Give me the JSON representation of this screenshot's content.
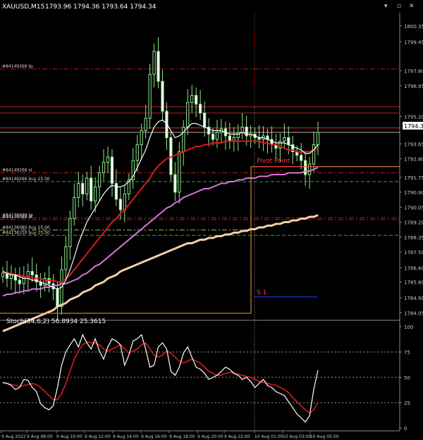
{
  "header": {
    "symbol": "XAUUSD,M15",
    "ohlc": "1793.96 1794.36 1793.64 1794.34"
  },
  "window_controls": {
    "minimize": "▾",
    "maximize": "▫",
    "close": "✕"
  },
  "price_axis": {
    "ticks": [
      "1800.35",
      "1799.45",
      "1797.80",
      "1796.95",
      "1795.20",
      "1794.34",
      "1793.65",
      "1792.80",
      "1791.75",
      "1790.90",
      "1790.05",
      "1789.20",
      "1788.35",
      "1787.50",
      "1786.60",
      "1785.80",
      "1784.90",
      "1784.05"
    ],
    "current_price": "1794.34",
    "colors": {
      "bg": "#000000",
      "grid": "#2f2f2f",
      "text": "#c8c8c8"
    }
  },
  "order_labels": [
    {
      "text": "#84149266 tp",
      "price": 1797.9
    },
    {
      "text": "#84149266 sl",
      "price": 1792.0
    },
    {
      "text": "#84149266 buy 25.00",
      "price": 1791.5
    },
    {
      "text": "#84136099 tp",
      "price": 1789.45
    },
    {
      "text": "#84136099 sl",
      "price": 1789.35
    },
    {
      "text": "#84136080 buy 25.00",
      "price": 1788.75
    },
    {
      "text": "#84136150 buy 25.00",
      "price": 1788.45
    }
  ],
  "pivot": {
    "label": "Pivot Point",
    "s1_label": "S 1",
    "price": 1792.35,
    "s1_price": 1784.95
  },
  "stoch": {
    "title": "Stoch(34,6,2) 56.8934 25.3615",
    "ticks": [
      "100",
      "75",
      "50",
      "25",
      "0"
    ],
    "levels": [
      75,
      50,
      25
    ]
  },
  "time_axis": {
    "labels": [
      "9 Aug 2022",
      "9 Aug 08:00",
      "9 Aug 10:00",
      "9 Aug 12:00",
      "9 Aug 14:00",
      "9 Aug 16:00",
      "9 Aug 18:00",
      "9 Aug 20:00",
      "9 Aug 22:00",
      "10 Aug 01:00",
      "10 Aug 03:00",
      "10 Aug 05:00"
    ]
  },
  "chart_data": {
    "type": "line",
    "title": "XAUUSD,M15",
    "price_range": [
      1783.7,
      1801.1
    ],
    "closes": [
      1786.3,
      1786.0,
      1786.2,
      1785.9,
      1785.7,
      1786.1,
      1786.4,
      1786.2,
      1785.8,
      1785.6,
      1786.0,
      1785.7,
      1785.4,
      1784.4,
      1786.5,
      1787.8,
      1789.4,
      1790.6,
      1791.4,
      1790.8,
      1791.7,
      1790.4,
      1791.2,
      1792.0,
      1792.6,
      1792.9,
      1791.4,
      1790.5,
      1789.9,
      1790.8,
      1791.6,
      1792.7,
      1793.6,
      1794.4,
      1795.1,
      1797.6,
      1798.9,
      1797.2,
      1795.5,
      1794.0,
      1791.9,
      1790.9,
      1793.2,
      1794.6,
      1796.0,
      1796.4,
      1795.9,
      1795.4,
      1794.6,
      1794.2,
      1793.9,
      1794.3,
      1794.5,
      1794.1,
      1793.8,
      1794.0,
      1794.3,
      1794.6,
      1794.1,
      1794.2,
      1794.0,
      1793.9,
      1794.1,
      1793.9,
      1793.6,
      1793.4,
      1793.8,
      1794.0,
      1793.6,
      1793.2,
      1793.0,
      1792.7,
      1791.9,
      1792.5,
      1793.6,
      1794.3
    ],
    "ma_fast": [
      1786.4,
      1786.3,
      1786.2,
      1786.2,
      1786.1,
      1786.0,
      1786.0,
      1785.9,
      1785.9,
      1785.8,
      1785.7,
      1785.6,
      1785.5,
      1785.4,
      1785.5,
      1785.9,
      1786.5,
      1787.2,
      1788.0,
      1788.6,
      1789.2,
      1789.6,
      1790.0,
      1790.4,
      1790.8,
      1791.1,
      1791.3,
      1791.2,
      1791.2,
      1791.3,
      1791.5,
      1791.8,
      1792.3,
      1792.8,
      1793.3,
      1794.0,
      1794.6,
      1794.9,
      1795.0,
      1794.8,
      1794.4,
      1794.0,
      1794.1,
      1794.3,
      1794.6,
      1794.8,
      1794.8,
      1794.7,
      1794.6,
      1794.5,
      1794.4,
      1794.4,
      1794.4,
      1794.3,
      1794.2,
      1794.2,
      1794.2,
      1794.3,
      1794.2,
      1794.2,
      1794.1,
      1794.0,
      1794.0,
      1793.9,
      1793.8,
      1793.7,
      1793.7,
      1793.7,
      1793.6,
      1793.5,
      1793.4,
      1793.3,
      1793.1,
      1793.1,
      1793.3,
      1793.6
    ],
    "ma_mid": [
      1786.4,
      1786.3,
      1786.3,
      1786.2,
      1786.2,
      1786.1,
      1786.1,
      1786.0,
      1786.0,
      1786.0,
      1785.9,
      1785.9,
      1785.9,
      1785.8,
      1785.8,
      1786.0,
      1786.2,
      1786.5,
      1786.8,
      1787.1,
      1787.4,
      1787.7,
      1788.0,
      1788.3,
      1788.6,
      1788.9,
      1789.2,
      1789.4,
      1789.7,
      1789.9,
      1790.2,
      1790.5,
      1790.8,
      1791.1,
      1791.4,
      1791.7,
      1792.1,
      1792.4,
      1792.6,
      1792.8,
      1792.9,
      1793.0,
      1793.1,
      1793.2,
      1793.3,
      1793.4,
      1793.5,
      1793.5,
      1793.6,
      1793.6,
      1793.7,
      1793.7,
      1793.7,
      1793.8,
      1793.8,
      1793.8,
      1793.8,
      1793.8,
      1793.8,
      1793.8,
      1793.8,
      1793.8,
      1793.7,
      1793.7,
      1793.6,
      1793.6,
      1793.5,
      1793.4,
      1793.3,
      1793.3,
      1793.2,
      1793.2,
      1793.2,
      1793.2,
      1793.3,
      1793.4
    ],
    "ma_slow": [
      1785.0,
      1785.1,
      1785.1,
      1785.2,
      1785.2,
      1785.3,
      1785.3,
      1785.4,
      1785.4,
      1785.4,
      1785.5,
      1785.5,
      1785.6,
      1785.6,
      1785.7,
      1785.7,
      1785.8,
      1785.9,
      1786.0,
      1786.2,
      1786.3,
      1786.5,
      1786.7,
      1786.8,
      1787.0,
      1787.2,
      1787.4,
      1787.6,
      1787.8,
      1788.0,
      1788.2,
      1788.4,
      1788.6,
      1788.8,
      1789.0,
      1789.2,
      1789.4,
      1789.6,
      1789.8,
      1790.0,
      1790.1,
      1790.3,
      1790.4,
      1790.6,
      1790.7,
      1790.8,
      1790.9,
      1791.0,
      1791.1,
      1791.1,
      1791.2,
      1791.3,
      1791.4,
      1791.4,
      1791.5,
      1791.5,
      1791.6,
      1791.6,
      1791.7,
      1791.7,
      1791.7,
      1791.8,
      1791.8,
      1791.8,
      1791.9,
      1791.9,
      1791.9,
      1791.9,
      1792.0,
      1792.0,
      1792.0,
      1792.0,
      1792.1,
      1792.1,
      1792.2,
      1792.3
    ],
    "ma_very_slow": [
      1783.0,
      1783.1,
      1783.2,
      1783.3,
      1783.4,
      1783.5,
      1783.6,
      1783.7,
      1783.8,
      1783.9,
      1784.0,
      1784.1,
      1784.2,
      1784.4,
      1784.5,
      1784.6,
      1784.8,
      1784.9,
      1785.0,
      1785.2,
      1785.3,
      1785.4,
      1785.6,
      1785.7,
      1785.8,
      1786.0,
      1786.1,
      1786.2,
      1786.4,
      1786.5,
      1786.6,
      1786.7,
      1786.8,
      1786.9,
      1787.0,
      1787.1,
      1787.2,
      1787.3,
      1787.4,
      1787.5,
      1787.6,
      1787.7,
      1787.8,
      1787.9,
      1788.0,
      1788.0,
      1788.1,
      1788.2,
      1788.2,
      1788.3,
      1788.3,
      1788.4,
      1788.4,
      1788.5,
      1788.5,
      1788.6,
      1788.6,
      1788.7,
      1788.7,
      1788.8,
      1788.8,
      1788.9,
      1788.9,
      1789.0,
      1789.0,
      1789.1,
      1789.1,
      1789.2,
      1789.2,
      1789.3,
      1789.3,
      1789.4,
      1789.4,
      1789.5,
      1789.5,
      1789.6
    ],
    "stoch_main": [
      45,
      44,
      42,
      38,
      40,
      48,
      47,
      40,
      36,
      24,
      20,
      18,
      22,
      40,
      62,
      75,
      82,
      88,
      80,
      92,
      84,
      78,
      88,
      76,
      68,
      80,
      88,
      86,
      82,
      62,
      72,
      86,
      88,
      92,
      78,
      60,
      62,
      80,
      84,
      78,
      56,
      52,
      60,
      74,
      80,
      70,
      60,
      58,
      54,
      48,
      50,
      52,
      56,
      60,
      58,
      54,
      52,
      48,
      50,
      46,
      40,
      44,
      48,
      42,
      40,
      36,
      34,
      32,
      26,
      20,
      14,
      10,
      6,
      12,
      38,
      57
    ],
    "stoch_signal": [
      44,
      44,
      43,
      42,
      41,
      42,
      43,
      44,
      43,
      40,
      36,
      32,
      28,
      28,
      34,
      44,
      56,
      68,
      76,
      82,
      85,
      84,
      84,
      82,
      78,
      76,
      78,
      80,
      82,
      78,
      74,
      76,
      78,
      82,
      84,
      78,
      72,
      70,
      72,
      76,
      74,
      70,
      66,
      64,
      66,
      68,
      66,
      64,
      60,
      56,
      54,
      52,
      52,
      54,
      55,
      54,
      53,
      52,
      51,
      50,
      48,
      46,
      45,
      44,
      43,
      42,
      40,
      38,
      35,
      30,
      26,
      22,
      18,
      15,
      18,
      25
    ]
  }
}
